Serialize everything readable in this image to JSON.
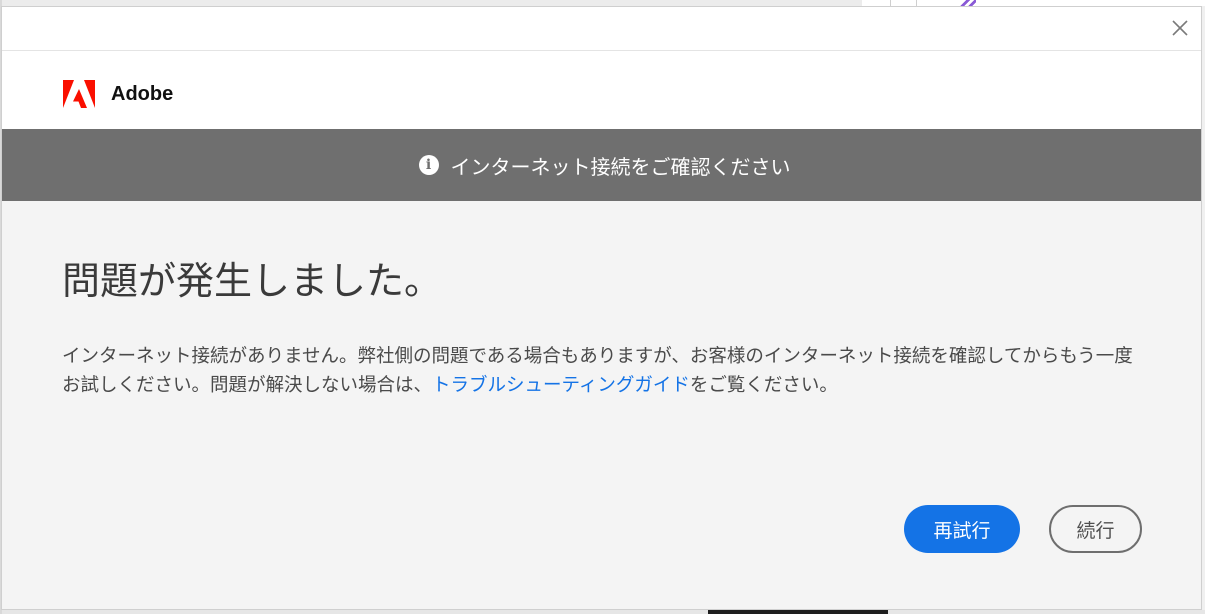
{
  "dialog": {
    "brand_name": "Adobe",
    "notice": {
      "icon": "info-icon",
      "text": "インターネット接続をご確認ください"
    },
    "heading": "問題が発生しました。",
    "message": {
      "text_before_link": "インターネット接続がありません。弊社側の問題である場合もありますが、お客様のインターネット接続を確認してからもう一度お試しください。問題が解決しない場合は、",
      "link_text": "トラブルシューティングガイド",
      "text_after_link": "をご覧ください。"
    },
    "buttons": {
      "retry_label": "再試行",
      "continue_label": "続行"
    },
    "close_icon": "close-icon"
  },
  "colors": {
    "accent": "#1473e6",
    "notice_bar": "#6f6f6f",
    "adobe_red": "#fa0f00"
  }
}
